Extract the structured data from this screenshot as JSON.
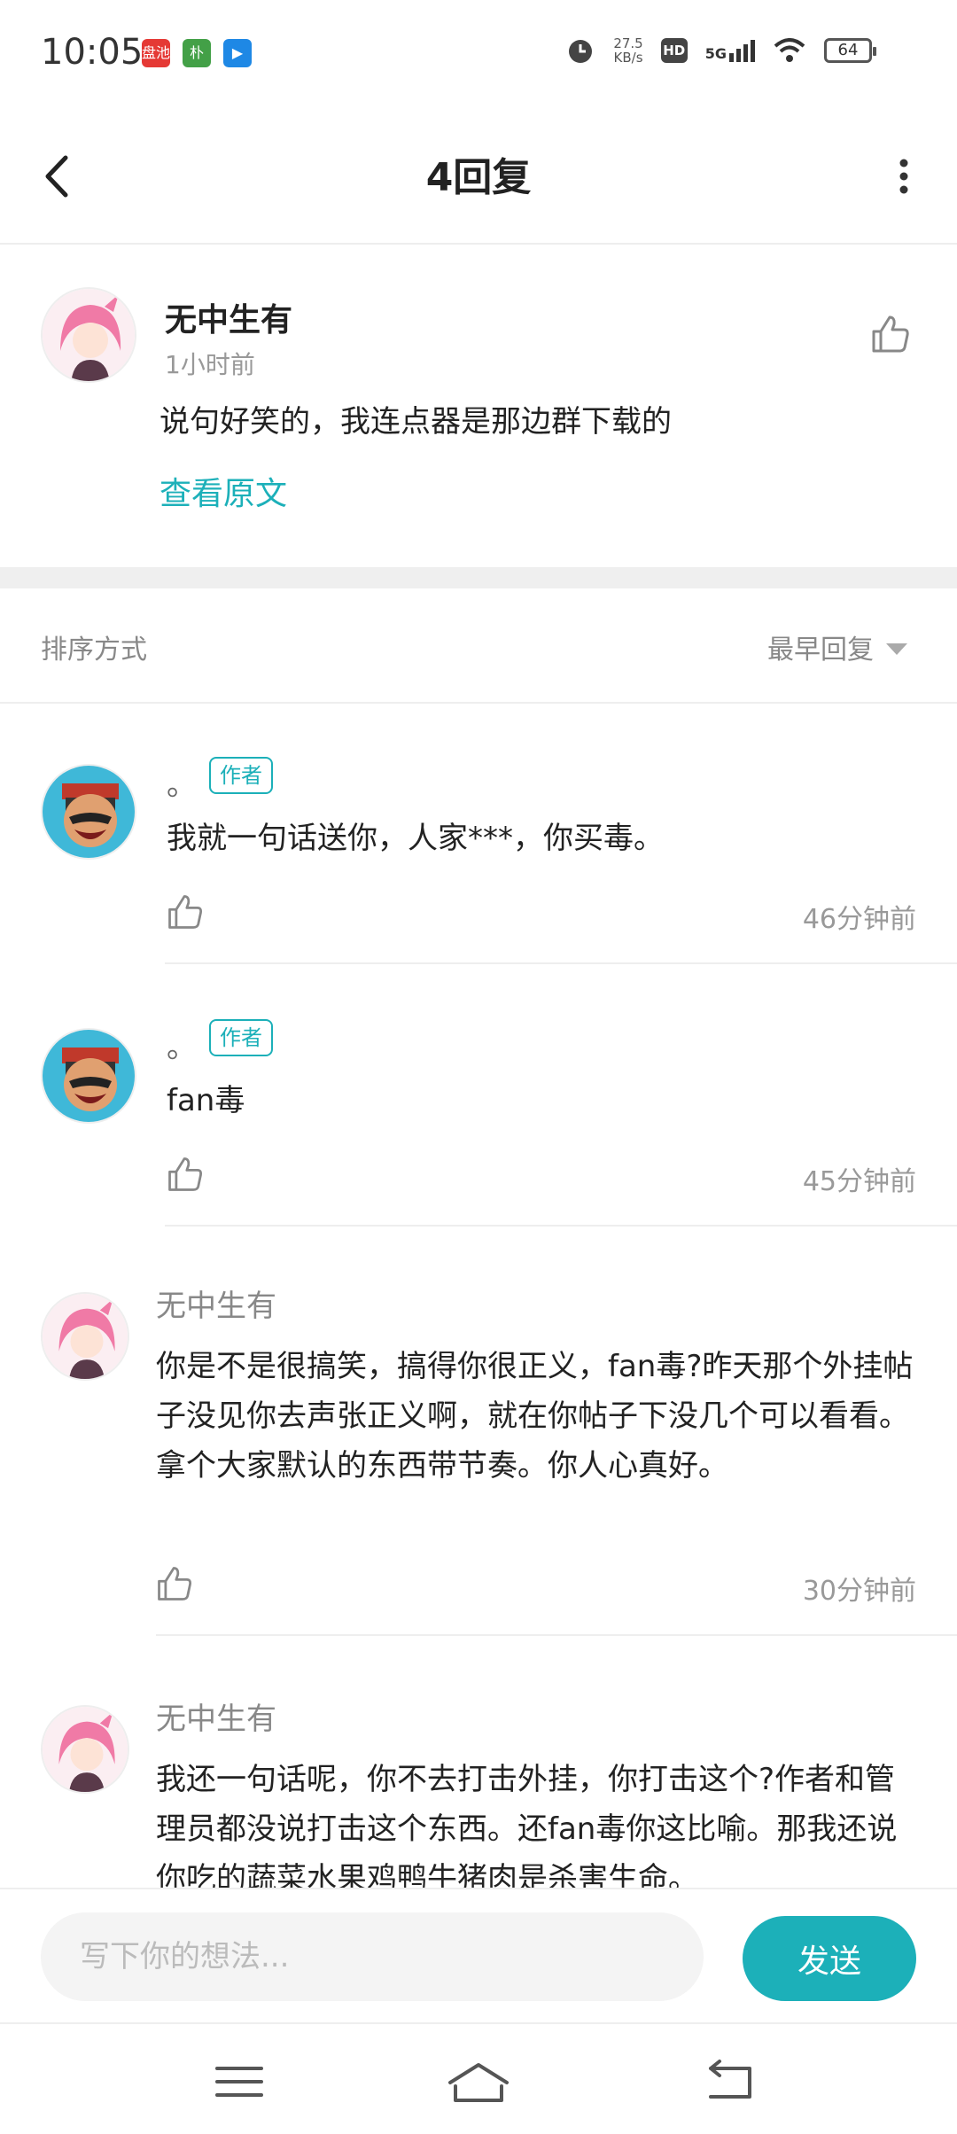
{
  "status": {
    "time": "10:05",
    "apps": [
      {
        "name": "盘池",
        "color": "#e53935"
      },
      {
        "name": "朴",
        "color": "#43a047"
      },
      {
        "name": "▶",
        "color": "#1e88e5"
      }
    ],
    "speed_value": "27.5",
    "speed_unit": "KB/s",
    "hd": "HD",
    "network": "5G",
    "battery": "64"
  },
  "header": {
    "title": "4回复"
  },
  "origin": {
    "name": "无中生有",
    "time": "1小时前",
    "text": "说句好笑的，我连点器是那边群下载的",
    "link": "查看原文"
  },
  "sort": {
    "label": "排序方式",
    "value": "最早回复"
  },
  "replies": [
    {
      "name": "。",
      "badge": "作者",
      "text": "我就一句话送你，人家***，你买毒。",
      "time": "46分钟前"
    },
    {
      "name": "。",
      "badge": "作者",
      "text": "fan毒",
      "time": "45分钟前"
    },
    {
      "name": "无中生有",
      "text": "你是不是很搞笑，搞得你很正义，fan毒?昨天那个外挂帖子没见你去声张正义啊，就在你帖子下没几个可以看看。拿个大家默认的东西带节奏。你人心真好。",
      "time": "30分钟前"
    },
    {
      "name": "无中生有",
      "text": "我还一句话呢，你不去打击外挂，你打击这个?作者和管理员都没说打击这个东西。还fan毒你这比喻。那我还说你吃的蔬菜水果鸡鸭牛猪肉是杀害生命。"
    }
  ],
  "input": {
    "placeholder": "写下你的想法...",
    "send": "发送"
  },
  "colors": {
    "accent": "#1cb0b9"
  }
}
